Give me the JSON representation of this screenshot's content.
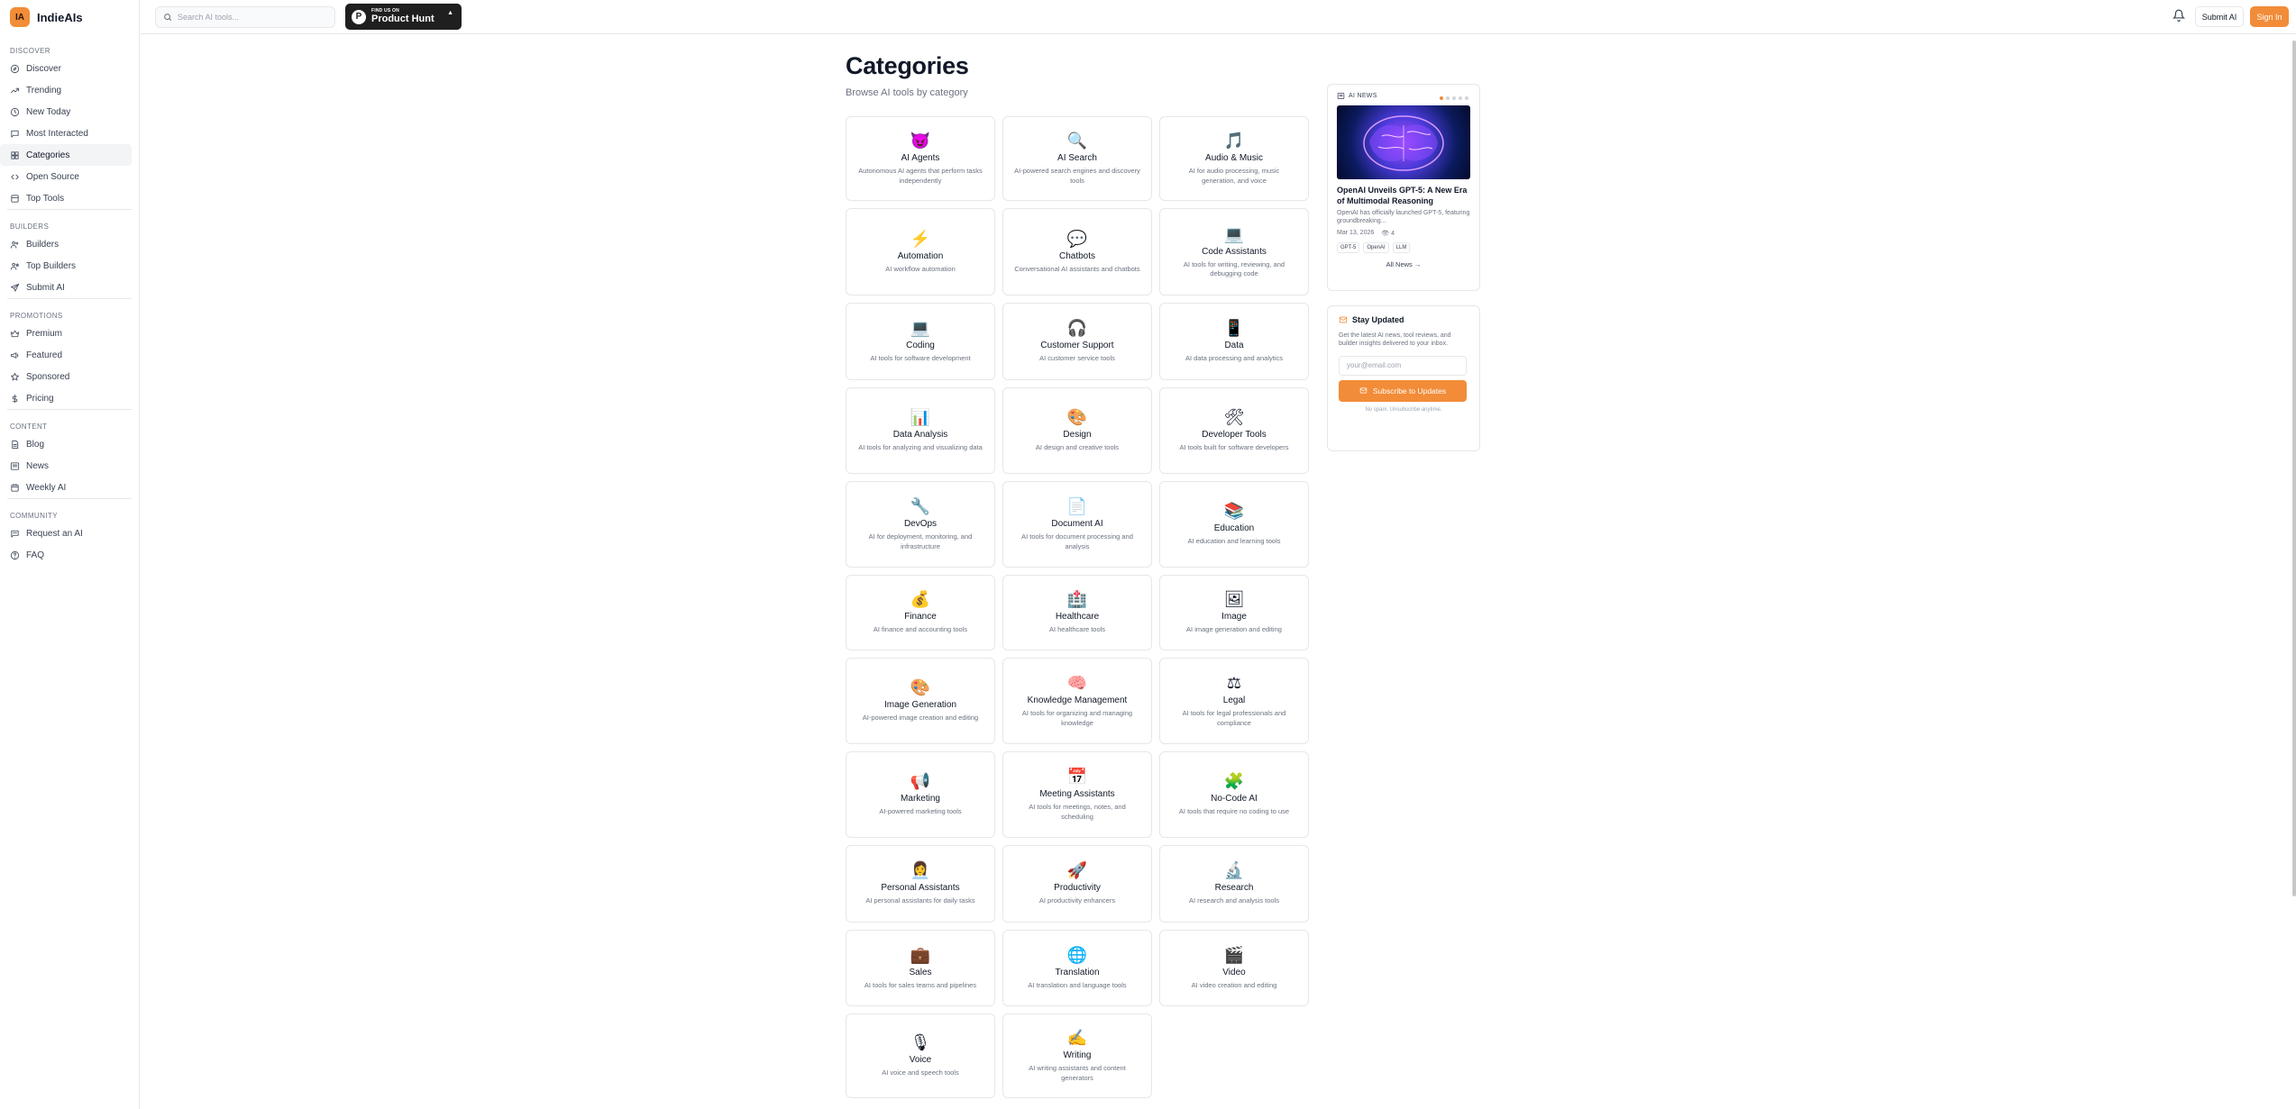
{
  "brand": {
    "logo": "IA",
    "name": "IndieAIs"
  },
  "sidebar": {
    "sections": [
      {
        "heading": "Discover",
        "items": [
          {
            "label": "Discover",
            "icon": "compass-icon"
          },
          {
            "label": "Trending",
            "icon": "trending-icon"
          },
          {
            "label": "New Today",
            "icon": "clock-icon"
          },
          {
            "label": "Most Interacted",
            "icon": "chat-icon"
          },
          {
            "label": "Categories",
            "icon": "grid-icon",
            "active": true
          },
          {
            "label": "Open Source",
            "icon": "code-icon"
          },
          {
            "label": "Top Tools",
            "icon": "box-icon"
          }
        ]
      },
      {
        "heading": "Builders",
        "items": [
          {
            "label": "Builders",
            "icon": "users-icon"
          },
          {
            "label": "Top Builders",
            "icon": "users-star-icon"
          },
          {
            "label": "Submit AI",
            "icon": "send-icon"
          }
        ]
      },
      {
        "heading": "Promotions",
        "items": [
          {
            "label": "Premium",
            "icon": "crown-icon"
          },
          {
            "label": "Featured",
            "icon": "megaphone-icon"
          },
          {
            "label": "Sponsored",
            "icon": "star-icon"
          },
          {
            "label": "Pricing",
            "icon": "dollar-icon"
          }
        ]
      },
      {
        "heading": "Content",
        "items": [
          {
            "label": "Blog",
            "icon": "document-icon"
          },
          {
            "label": "News",
            "icon": "newspaper-icon"
          },
          {
            "label": "Weekly AI",
            "icon": "calendar-icon"
          }
        ]
      },
      {
        "heading": "Community",
        "items": [
          {
            "label": "Request an AI",
            "icon": "chat-bubble-icon"
          },
          {
            "label": "FAQ",
            "icon": "question-icon"
          }
        ]
      }
    ]
  },
  "topbar": {
    "search_placeholder": "Search AI tools...",
    "product_hunt": {
      "small": "FIND US ON",
      "big": "Product Hunt",
      "letter": "P"
    },
    "submit_label": "Submit AI",
    "signin_label": "Sign In"
  },
  "main": {
    "title": "Categories",
    "subtitle": "Browse AI tools by category",
    "categories": [
      {
        "icon": "😈",
        "name": "AI Agents",
        "desc": "Autonomous AI agents that perform tasks independently"
      },
      {
        "icon": "🔍",
        "name": "AI Search",
        "desc": "AI-powered search engines and discovery tools"
      },
      {
        "icon": "🎵",
        "name": "Audio & Music",
        "desc": "AI for audio processing, music generation, and voice"
      },
      {
        "icon": "⚡",
        "name": "Automation",
        "desc": "AI workflow automation"
      },
      {
        "icon": "💬",
        "name": "Chatbots",
        "desc": "Conversational AI assistants and chatbots"
      },
      {
        "icon": "💻",
        "name": "Code Assistants",
        "desc": "AI tools for writing, reviewing, and debugging code"
      },
      {
        "icon": "💻",
        "name": "Coding",
        "desc": "AI tools for software development"
      },
      {
        "icon": "🎧",
        "name": "Customer Support",
        "desc": "AI customer service tools"
      },
      {
        "icon": "📱",
        "name": "Data",
        "desc": "AI data processing and analytics"
      },
      {
        "icon": "📊",
        "name": "Data Analysis",
        "desc": "AI tools for analyzing and visualizing data"
      },
      {
        "icon": "🎨",
        "name": "Design",
        "desc": "AI design and creative tools"
      },
      {
        "icon": "🛠",
        "name": "Developer Tools",
        "desc": "AI tools built for software developers"
      },
      {
        "icon": "🔧",
        "name": "DevOps",
        "desc": "AI for deployment, monitoring, and infrastructure"
      },
      {
        "icon": "📄",
        "name": "Document AI",
        "desc": "AI tools for document processing and analysis"
      },
      {
        "icon": "📚",
        "name": "Education",
        "desc": "AI education and learning tools"
      },
      {
        "icon": "💰",
        "name": "Finance",
        "desc": "AI finance and accounting tools"
      },
      {
        "icon": "🏥",
        "name": "Healthcare",
        "desc": "AI healthcare tools"
      },
      {
        "icon": "🖼",
        "name": "Image",
        "desc": "AI image generation and editing"
      },
      {
        "icon": "🎨",
        "name": "Image Generation",
        "desc": "AI-powered image creation and editing"
      },
      {
        "icon": "🧠",
        "name": "Knowledge Management",
        "desc": "AI tools for organizing and managing knowledge"
      },
      {
        "icon": "⚖",
        "name": "Legal",
        "desc": "AI tools for legal professionals and compliance"
      },
      {
        "icon": "📢",
        "name": "Marketing",
        "desc": "AI-powered marketing tools"
      },
      {
        "icon": "📅",
        "name": "Meeting Assistants",
        "desc": "AI tools for meetings, notes, and scheduling"
      },
      {
        "icon": "🧩",
        "name": "No-Code AI",
        "desc": "AI tools that require no coding to use"
      },
      {
        "icon": "👩‍💼",
        "name": "Personal Assistants",
        "desc": "AI personal assistants for daily tasks"
      },
      {
        "icon": "🚀",
        "name": "Productivity",
        "desc": "AI productivity enhancers"
      },
      {
        "icon": "🔬",
        "name": "Research",
        "desc": "AI research and analysis tools"
      },
      {
        "icon": "💼",
        "name": "Sales",
        "desc": "AI tools for sales teams and pipelines"
      },
      {
        "icon": "🌐",
        "name": "Translation",
        "desc": "AI translation and language tools"
      },
      {
        "icon": "🎬",
        "name": "Video",
        "desc": "AI video creation and editing"
      },
      {
        "icon": "🎙",
        "name": "Voice",
        "desc": "AI voice and speech tools"
      },
      {
        "icon": "✍",
        "name": "Writing",
        "desc": "AI writing assistants and content generators"
      }
    ]
  },
  "news": {
    "heading": "AI NEWS",
    "title": "OpenAI Unveils GPT-5: A New Era of Multimodal Reasoning",
    "desc": "OpenAI has officially launched GPT-5, featuring groundbreaking...",
    "date": "Mar 13, 2026",
    "views": "4",
    "tags": [
      "GPT-5",
      "OpenAI",
      "LLM"
    ],
    "all_label": "All News →"
  },
  "subscribe": {
    "heading": "Stay Updated",
    "desc": "Get the latest AI news, tool reviews, and builder insights delivered to your inbox.",
    "placeholder": "your@email.com",
    "button": "Subscribe to Updates",
    "note": "No spam. Unsubscribe anytime."
  },
  "colors": {
    "accent": "#f28c38",
    "border": "#e5e7eb",
    "muted": "#6b7280"
  }
}
